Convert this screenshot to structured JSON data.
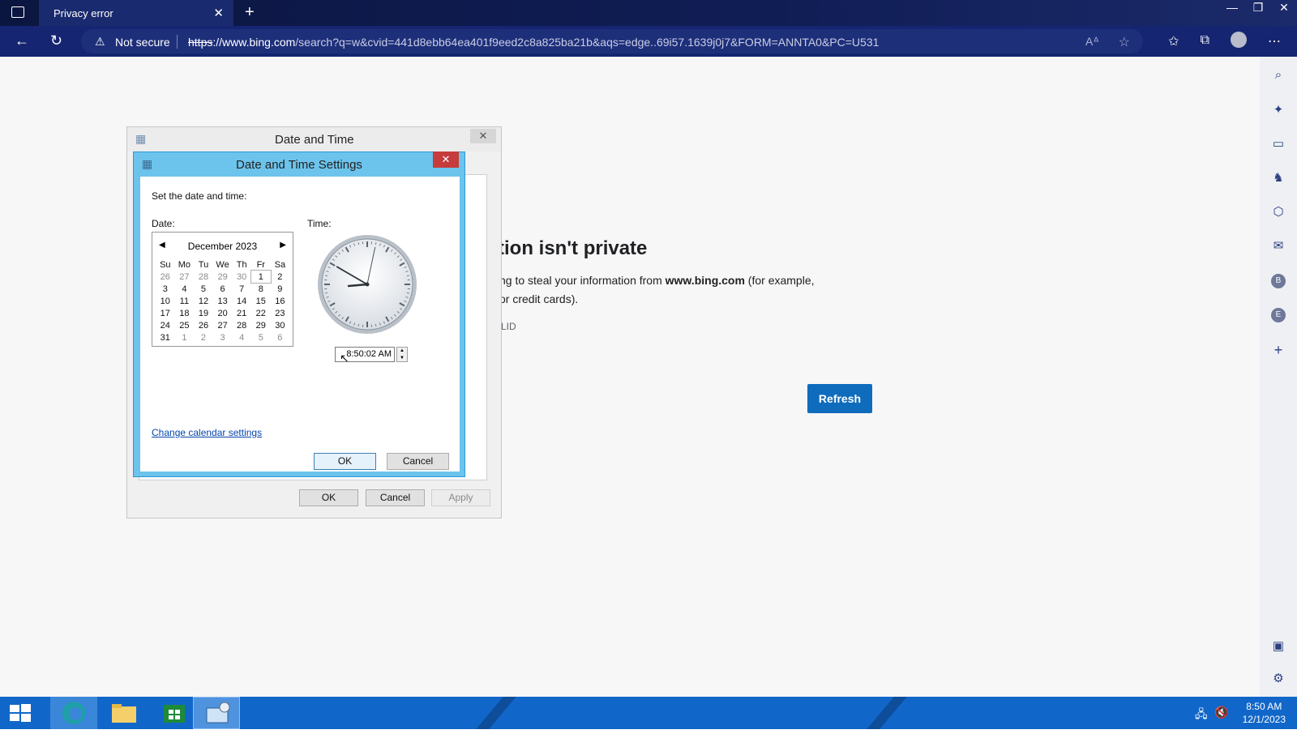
{
  "browser": {
    "tab_title": "Privacy error",
    "tab_close": "✕",
    "new_tab": "+",
    "address": {
      "security_label": "Not secure",
      "url_scheme": "https",
      "url_host": "://www.bing.com",
      "url_rest": "/search?q=w&cvid=441d8ebb64ea401f9eed2c8a825ba21b&aqs=edge..69i57.1639j0j7&FORM=ANNTA0&PC=U531"
    }
  },
  "page": {
    "title_partial": "tion isn't private",
    "body_line1_prefix": "ng to steal your information from ",
    "body_line1_host": "www.bing.com",
    "body_line1_suffix": " (for example,",
    "body_line2": "or credit cards).",
    "error_code_partial": "LID",
    "refresh_label": "Refresh"
  },
  "outer_dialog": {
    "title": "Date and Time",
    "ok": "OK",
    "cancel": "Cancel",
    "apply": "Apply"
  },
  "inner_dialog": {
    "title": "Date and Time Settings",
    "prompt": "Set the date and time:",
    "date_label": "Date:",
    "time_label": "Time:",
    "month_year": "December 2023",
    "weekdays": [
      "Su",
      "Mo",
      "Tu",
      "We",
      "Th",
      "Fr",
      "Sa"
    ],
    "weeks": [
      [
        "26",
        "27",
        "28",
        "29",
        "30",
        "1",
        "2"
      ],
      [
        "3",
        "4",
        "5",
        "6",
        "7",
        "8",
        "9"
      ],
      [
        "10",
        "11",
        "12",
        "13",
        "14",
        "15",
        "16"
      ],
      [
        "17",
        "18",
        "19",
        "20",
        "21",
        "22",
        "23"
      ],
      [
        "24",
        "25",
        "26",
        "27",
        "28",
        "29",
        "30"
      ],
      [
        "31",
        "1",
        "2",
        "3",
        "4",
        "5",
        "6"
      ]
    ],
    "time_value": "8:50:02 AM",
    "change_calendar": "Change calendar settings",
    "ok": "OK",
    "cancel": "Cancel"
  },
  "clock_face": {
    "hour": 8,
    "minute": 50,
    "second": 2
  },
  "taskbar": {
    "time": "8:50 AM",
    "date": "12/1/2023"
  },
  "colors": {
    "accent": "#0f6cbd",
    "title_bar": "#101d55",
    "taskbar": "#1167c9",
    "dialog_frame": "#6cc3ec",
    "close_red": "#c63b3b"
  }
}
